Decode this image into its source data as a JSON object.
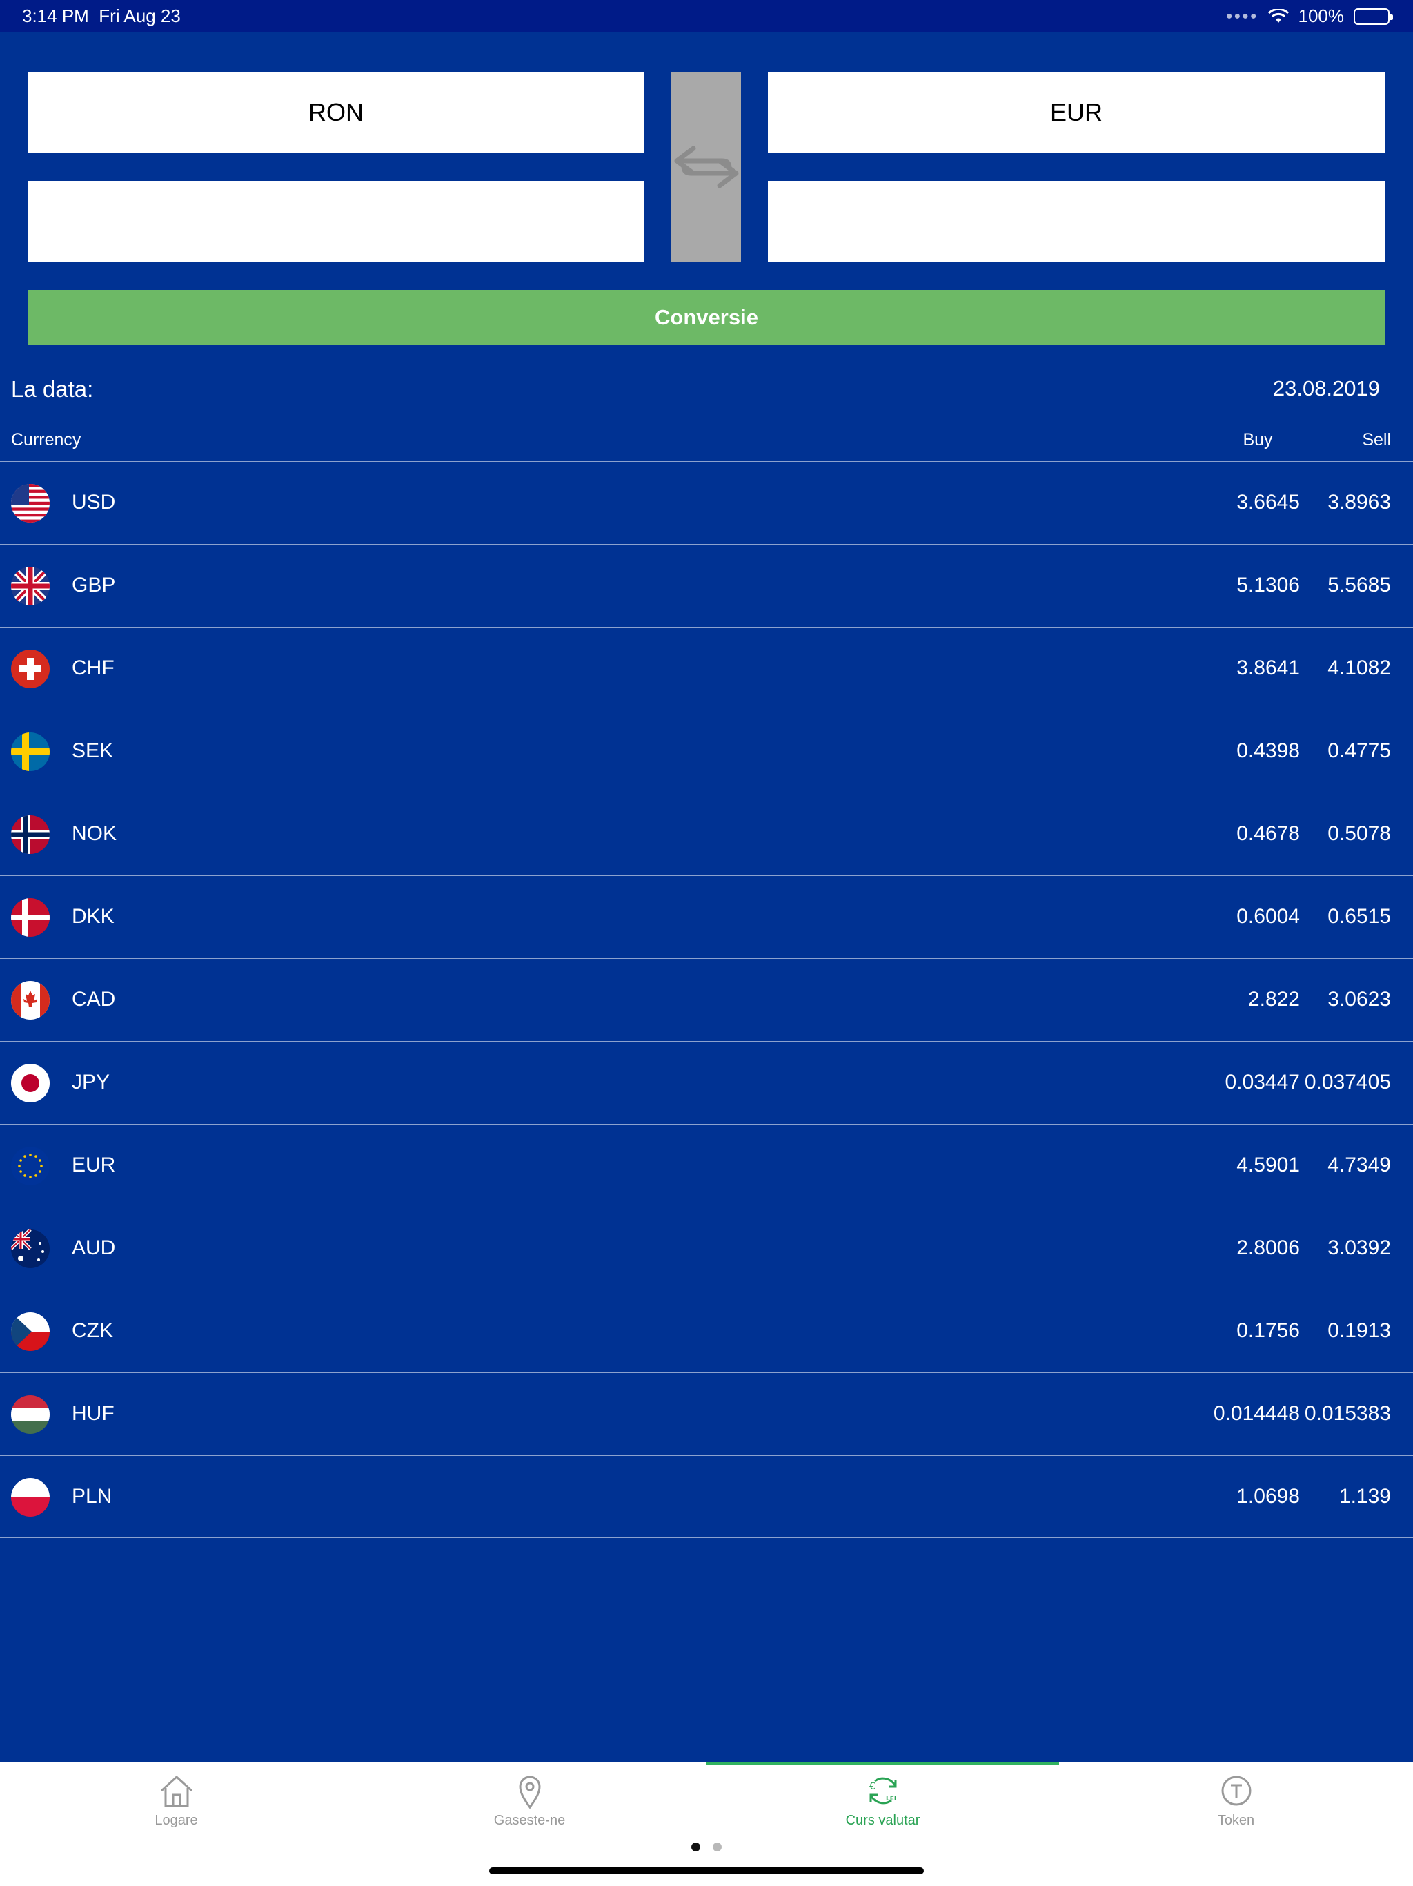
{
  "status_bar": {
    "time": "3:14 PM",
    "date": "Fri Aug 23",
    "battery": "100%"
  },
  "converter": {
    "from_currency": "RON",
    "to_currency": "EUR",
    "from_amount": "",
    "to_amount": "",
    "convert_label": "Conversie"
  },
  "date_row": {
    "label": "La data:",
    "value": "23.08.2019"
  },
  "table_header": {
    "currency": "Currency",
    "buy": "Buy",
    "sell": "Sell"
  },
  "rates": [
    {
      "code": "USD",
      "buy": "3.6645",
      "sell": "3.8963",
      "flag": "us-flag-icon"
    },
    {
      "code": "GBP",
      "buy": "5.1306",
      "sell": "5.5685",
      "flag": "uk-flag-icon"
    },
    {
      "code": "CHF",
      "buy": "3.8641",
      "sell": "4.1082",
      "flag": "swiss-flag-icon"
    },
    {
      "code": "SEK",
      "buy": "0.4398",
      "sell": "0.4775",
      "flag": "sweden-flag-icon"
    },
    {
      "code": "NOK",
      "buy": "0.4678",
      "sell": "0.5078",
      "flag": "norway-flag-icon"
    },
    {
      "code": "DKK",
      "buy": "0.6004",
      "sell": "0.6515",
      "flag": "denmark-flag-icon"
    },
    {
      "code": "CAD",
      "buy": "2.822",
      "sell": "3.0623",
      "flag": "canada-flag-icon"
    },
    {
      "code": "JPY",
      "buy": "0.03447",
      "sell": "0.037405",
      "flag": "japan-flag-icon"
    },
    {
      "code": "EUR",
      "buy": "4.5901",
      "sell": "4.7349",
      "flag": "eu-flag-icon"
    },
    {
      "code": "AUD",
      "buy": "2.8006",
      "sell": "3.0392",
      "flag": "australia-flag-icon"
    },
    {
      "code": "CZK",
      "buy": "0.1756",
      "sell": "0.1913",
      "flag": "czech-flag-icon"
    },
    {
      "code": "HUF",
      "buy": "0.014448",
      "sell": "0.015383",
      "flag": "hungary-flag-icon"
    },
    {
      "code": "PLN",
      "buy": "1.0698",
      "sell": "1.139",
      "flag": "poland-flag-icon"
    }
  ],
  "tabs": [
    {
      "label": "Logare",
      "icon": "home-icon"
    },
    {
      "label": "Gaseste-ne",
      "icon": "location-pin-icon"
    },
    {
      "label": "Curs valutar",
      "icon": "currency-exchange-icon",
      "active": true
    },
    {
      "label": "Token",
      "icon": "token-icon"
    }
  ],
  "colors": {
    "background": "#003293",
    "convert_button": "#6db966",
    "active_tab": "#2aa354"
  }
}
